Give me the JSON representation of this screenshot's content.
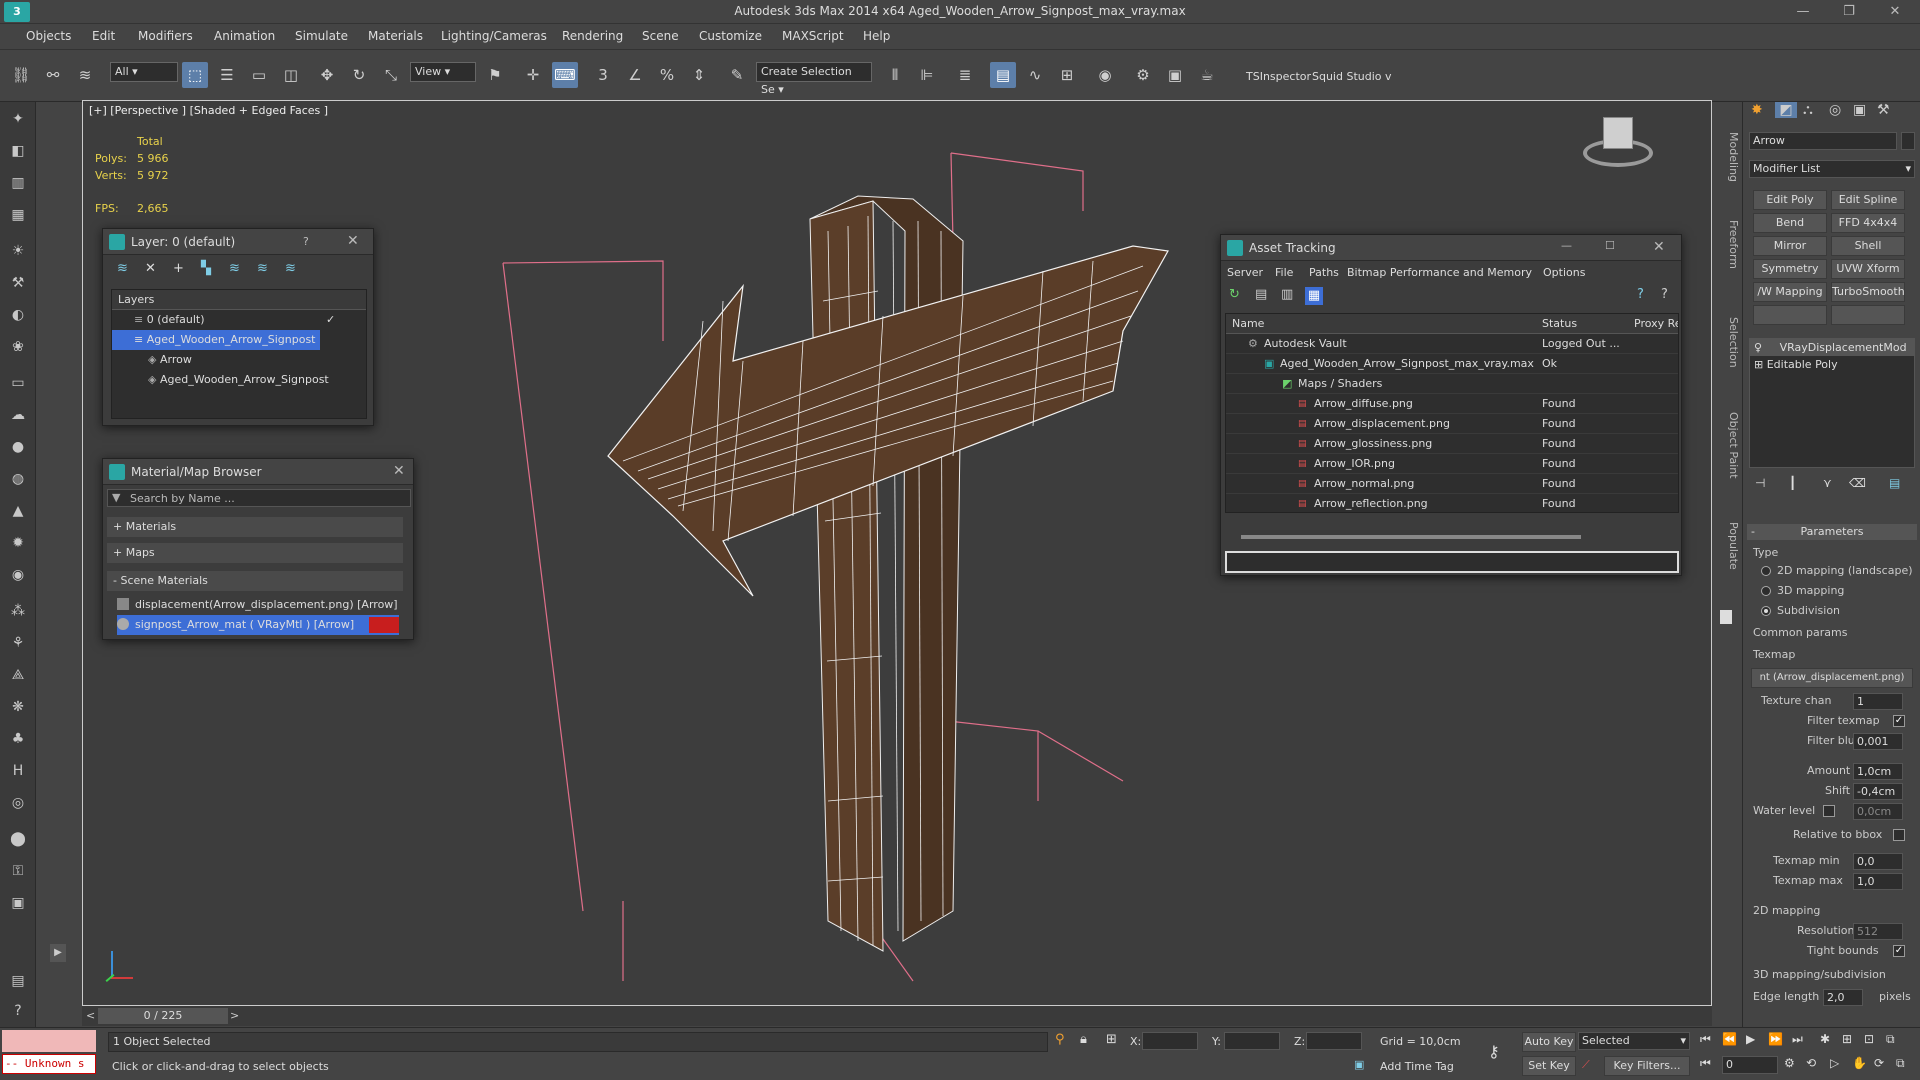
{
  "title": "Autodesk 3ds Max  2014 x64     Aged_Wooden_Arrow_Signpost_max_vray.max",
  "menu": [
    "Objects",
    "Edit",
    "Modifiers",
    "Animation",
    "Simulate",
    "Materials",
    "Lighting/Cameras",
    "Rendering",
    "Scene",
    "Customize",
    "MAXScript",
    "Help"
  ],
  "toolbar": {
    "filter": "All",
    "ref_coord": "View",
    "selection_set": "Create Selection Se",
    "tsinspector": "TSInspector",
    "squid": "Squid Studio v"
  },
  "viewport": {
    "label": "[+] [Perspective ] [Shaded + Edged Faces ]",
    "stats_header": "Total",
    "polys_label": "Polys:",
    "polys": "5 966",
    "verts_label": "Verts:",
    "verts": "5 972",
    "fps_label": "FPS:",
    "fps": "2,665"
  },
  "layer_dialog": {
    "title": "Layer: 0 (default)",
    "help": "?",
    "header": "Layers",
    "items": [
      "0 (default)",
      "Aged_Wooden_Arrow_Signpost",
      "Arrow",
      "Aged_Wooden_Arrow_Signpost"
    ]
  },
  "material_browser": {
    "title": "Material/Map Browser",
    "search_placeholder": "Search by Name ...",
    "groups": [
      "+ Materials",
      "+ Maps",
      "- Scene Materials"
    ],
    "items": [
      "displacement(Arrow_displacement.png) [Arrow]",
      "signpost_Arrow_mat ( VRayMtl ) [Arrow]"
    ]
  },
  "asset_tracking": {
    "title": "Asset Tracking",
    "menu": [
      "Server",
      "File",
      "Paths",
      "Bitmap Performance and Memory",
      "Options"
    ],
    "columns": [
      "Name",
      "Status",
      "Proxy Re"
    ],
    "rows": [
      {
        "name": "Autodesk Vault",
        "status": "Logged Out ..."
      },
      {
        "name": "Aged_Wooden_Arrow_Signpost_max_vray.max",
        "status": "Ok"
      },
      {
        "name": "Maps / Shaders",
        "status": ""
      },
      {
        "name": "Arrow_diffuse.png",
        "status": "Found"
      },
      {
        "name": "Arrow_displacement.png",
        "status": "Found"
      },
      {
        "name": "Arrow_glossiness.png",
        "status": "Found"
      },
      {
        "name": "Arrow_IOR.png",
        "status": "Found"
      },
      {
        "name": "Arrow_normal.png",
        "status": "Found"
      },
      {
        "name": "Arrow_reflection.png",
        "status": "Found"
      }
    ]
  },
  "viewport_tabs": [
    "Modeling",
    "Freeform",
    "Selection",
    "Object Paint",
    "Populate"
  ],
  "command_panel": {
    "object_name": "Arrow",
    "modifier_list": "Modifier List",
    "modifier_buttons": [
      "Edit Poly",
      "Edit Spline",
      "Bend",
      "FFD 4x4x4",
      "Mirror",
      "Shell",
      "Symmetry",
      "UVW Xform",
      "/W Mapping Ac",
      "TurboSmooth"
    ],
    "stack": [
      "VRayDisplacementMod",
      "Editable Poly"
    ],
    "parameters_header": "Parameters",
    "type_label": "Type",
    "type_options": [
      "2D mapping (landscape)",
      "3D mapping",
      "Subdivision"
    ],
    "common_params": "Common params",
    "texmap_label": "Texmap",
    "texmap_value": "nt (Arrow_displacement.png)",
    "texture_chan_label": "Texture chan",
    "texture_chan": "1",
    "filter_texmap_label": "Filter texmap",
    "filter_blur_label": "Filter blur",
    "filter_blur": "0,001",
    "amount_label": "Amount",
    "amount": "1,0cm",
    "shift_label": "Shift",
    "shift": "-0,4cm",
    "water_level_label": "Water level",
    "water_level": "0,0cm",
    "relative_bbox_label": "Relative to bbox",
    "texmap_min_label": "Texmap min",
    "texmap_min": "0,0",
    "texmap_max_label": "Texmap max",
    "texmap_max": "1,0",
    "mapping2d_header": "2D mapping",
    "resolution_label": "Resolution",
    "resolution": "512",
    "tight_bounds_label": "Tight bounds",
    "mapping3d_header": "3D mapping/subdivision",
    "edge_length_label": "Edge length",
    "edge_length": "2,0",
    "pixels_label": "pixels"
  },
  "timeline": {
    "frame": "0 / 225",
    "prev": "<",
    "next": ">"
  },
  "status": {
    "unknown": "-- Unknown s",
    "selected_count": "1 Object Selected",
    "prompt": "Click or click-and-drag to select objects",
    "x_label": "X:",
    "y_label": "Y:",
    "z_label": "Z:",
    "grid": "Grid = 10,0cm",
    "auto_key": "Auto Key",
    "set_key": "Set Key",
    "selected": "Selected",
    "key_filters": "Key Filters...",
    "add_time_tag": "Add Time Tag",
    "current_frame": "0"
  }
}
